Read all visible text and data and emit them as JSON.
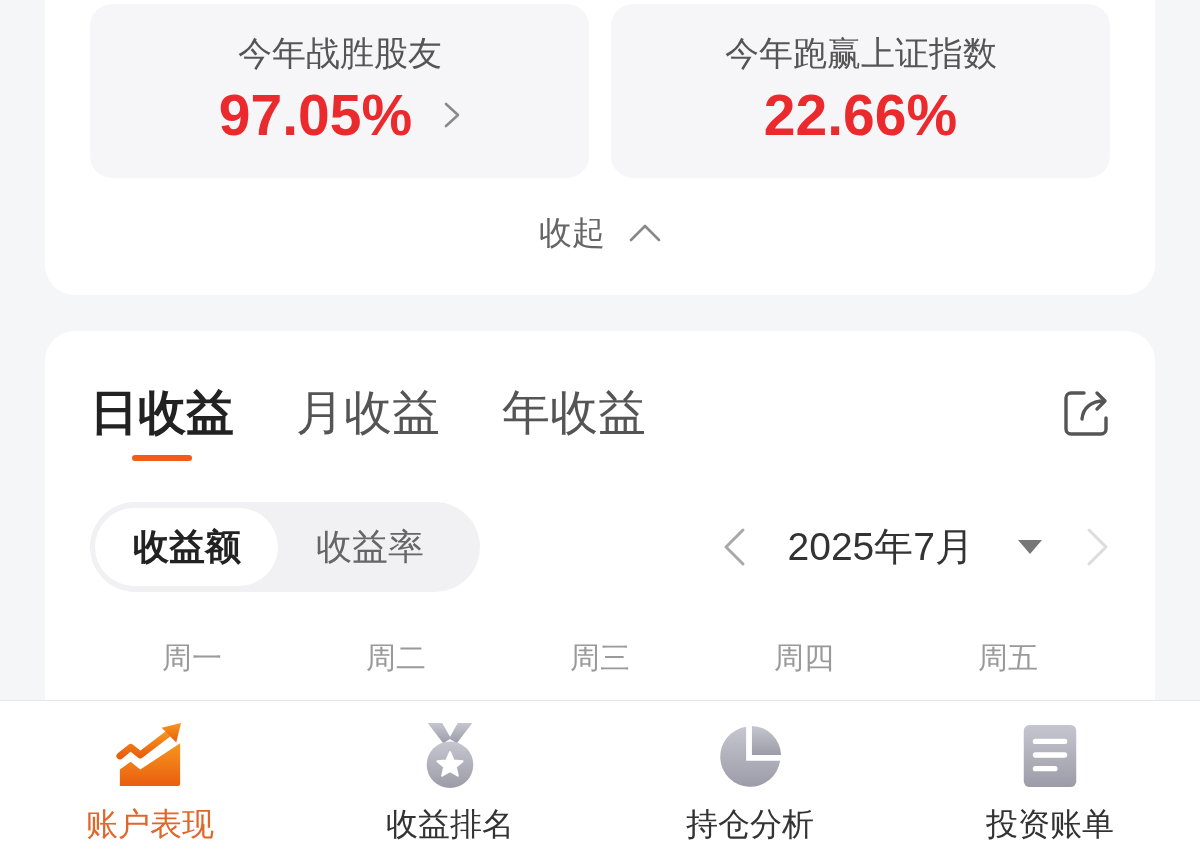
{
  "stats": [
    {
      "label": "今年战胜股友",
      "value": "97.05%",
      "linked": true
    },
    {
      "label": "今年跑赢上证指数",
      "value": "22.66%",
      "linked": false
    }
  ],
  "collapse": {
    "label": "收起"
  },
  "tabs": [
    {
      "label": "日收益",
      "selected": true
    },
    {
      "label": "月收益",
      "selected": false
    },
    {
      "label": "年收益",
      "selected": false
    }
  ],
  "metric_toggle": [
    {
      "label": "收益额",
      "selected": true
    },
    {
      "label": "收益率",
      "selected": false
    }
  ],
  "month_nav": {
    "label": "2025年7月",
    "prev_disabled": false,
    "next_disabled": true
  },
  "weekdays": [
    "周一",
    "周二",
    "周三",
    "周四",
    "周五"
  ],
  "bottom_nav": [
    {
      "label": "账户表现",
      "selected": true
    },
    {
      "label": "收益排名",
      "selected": false
    },
    {
      "label": "持仓分析",
      "selected": false
    },
    {
      "label": "投资账单",
      "selected": false
    }
  ]
}
